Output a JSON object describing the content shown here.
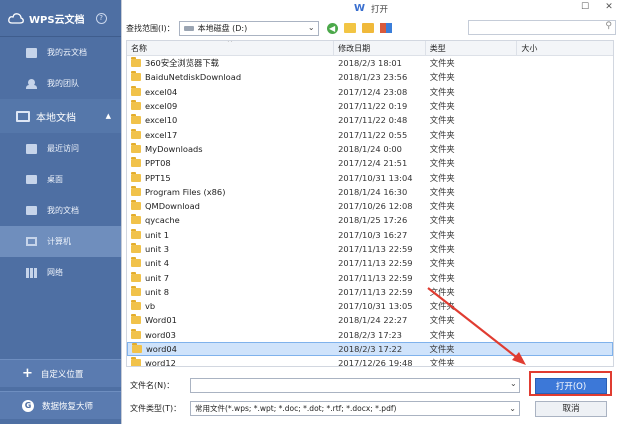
{
  "sidebar": {
    "title": "WPS云文档",
    "help": "?",
    "cloud_items": [
      {
        "label": "我的云文档",
        "icon": "cloud-doc-icon"
      },
      {
        "label": "我的团队",
        "icon": "team-icon"
      }
    ],
    "local_section": {
      "label": "本地文档",
      "caret": "▲"
    },
    "local_items": [
      {
        "label": "最近访问",
        "icon": "recent-icon"
      },
      {
        "label": "桌面",
        "icon": "desktop-icon"
      },
      {
        "label": "我的文档",
        "icon": "documents-icon"
      },
      {
        "label": "计算机",
        "icon": "computer-icon"
      },
      {
        "label": "网络",
        "icon": "network-icon"
      }
    ],
    "custom_location": "自定义位置",
    "data_recovery": "数据恢复大师"
  },
  "dialog": {
    "title": "打开",
    "look_in_label": "查找范围(I)：",
    "look_in_value": "本地磁盘 (D:)",
    "columns": {
      "name": "名称",
      "date": "修改日期",
      "type": "类型",
      "size": "大小"
    },
    "files": [
      {
        "name": "360安全浏览器下载",
        "date": "2018/2/3 18:01",
        "type": "文件夹"
      },
      {
        "name": "BaiduNetdiskDownload",
        "date": "2018/1/23 23:56",
        "type": "文件夹"
      },
      {
        "name": "excel04",
        "date": "2017/12/4 23:08",
        "type": "文件夹"
      },
      {
        "name": "excel09",
        "date": "2017/11/22 0:19",
        "type": "文件夹"
      },
      {
        "name": "excel10",
        "date": "2017/11/22 0:48",
        "type": "文件夹"
      },
      {
        "name": "excel17",
        "date": "2017/11/22 0:55",
        "type": "文件夹"
      },
      {
        "name": "MyDownloads",
        "date": "2018/1/24 0:00",
        "type": "文件夹"
      },
      {
        "name": "PPT08",
        "date": "2017/12/4 21:51",
        "type": "文件夹"
      },
      {
        "name": "PPT15",
        "date": "2017/10/31 13:04",
        "type": "文件夹"
      },
      {
        "name": "Program Files (x86)",
        "date": "2018/1/24 16:30",
        "type": "文件夹"
      },
      {
        "name": "QMDownload",
        "date": "2017/10/26 12:08",
        "type": "文件夹"
      },
      {
        "name": "qycache",
        "date": "2018/1/25 17:26",
        "type": "文件夹"
      },
      {
        "name": "unit 1",
        "date": "2017/10/3 16:27",
        "type": "文件夹"
      },
      {
        "name": "unit 3",
        "date": "2017/11/13 22:59",
        "type": "文件夹"
      },
      {
        "name": "unit 4",
        "date": "2017/11/13 22:59",
        "type": "文件夹"
      },
      {
        "name": "unit 7",
        "date": "2017/11/13 22:59",
        "type": "文件夹"
      },
      {
        "name": "unit 8",
        "date": "2017/11/13 22:59",
        "type": "文件夹"
      },
      {
        "name": "vb",
        "date": "2017/10/31 13:05",
        "type": "文件夹"
      },
      {
        "name": "Word01",
        "date": "2018/1/24 22:27",
        "type": "文件夹"
      },
      {
        "name": "word03",
        "date": "2018/2/3 17:23",
        "type": "文件夹"
      },
      {
        "name": "word04",
        "date": "2018/2/3 17:22",
        "type": "文件夹",
        "selected": true
      },
      {
        "name": "word12",
        "date": "2017/12/26 19:48",
        "type": "文件夹"
      }
    ],
    "filename_label": "文件名(N)：",
    "filename_value": "",
    "filetype_label": "文件类型(T)：",
    "filetype_value": "常用文件(*.wps; *.wpt; *.doc; *.dot; *.rtf; *.docx; *.pdf)",
    "open_button": "打开(O)",
    "cancel_button": "取消"
  },
  "colors": {
    "sidebar": "#4e6fa3",
    "accent": "#3c78d8",
    "annotation": "#e03c31",
    "selection": "#cfe3fb"
  }
}
